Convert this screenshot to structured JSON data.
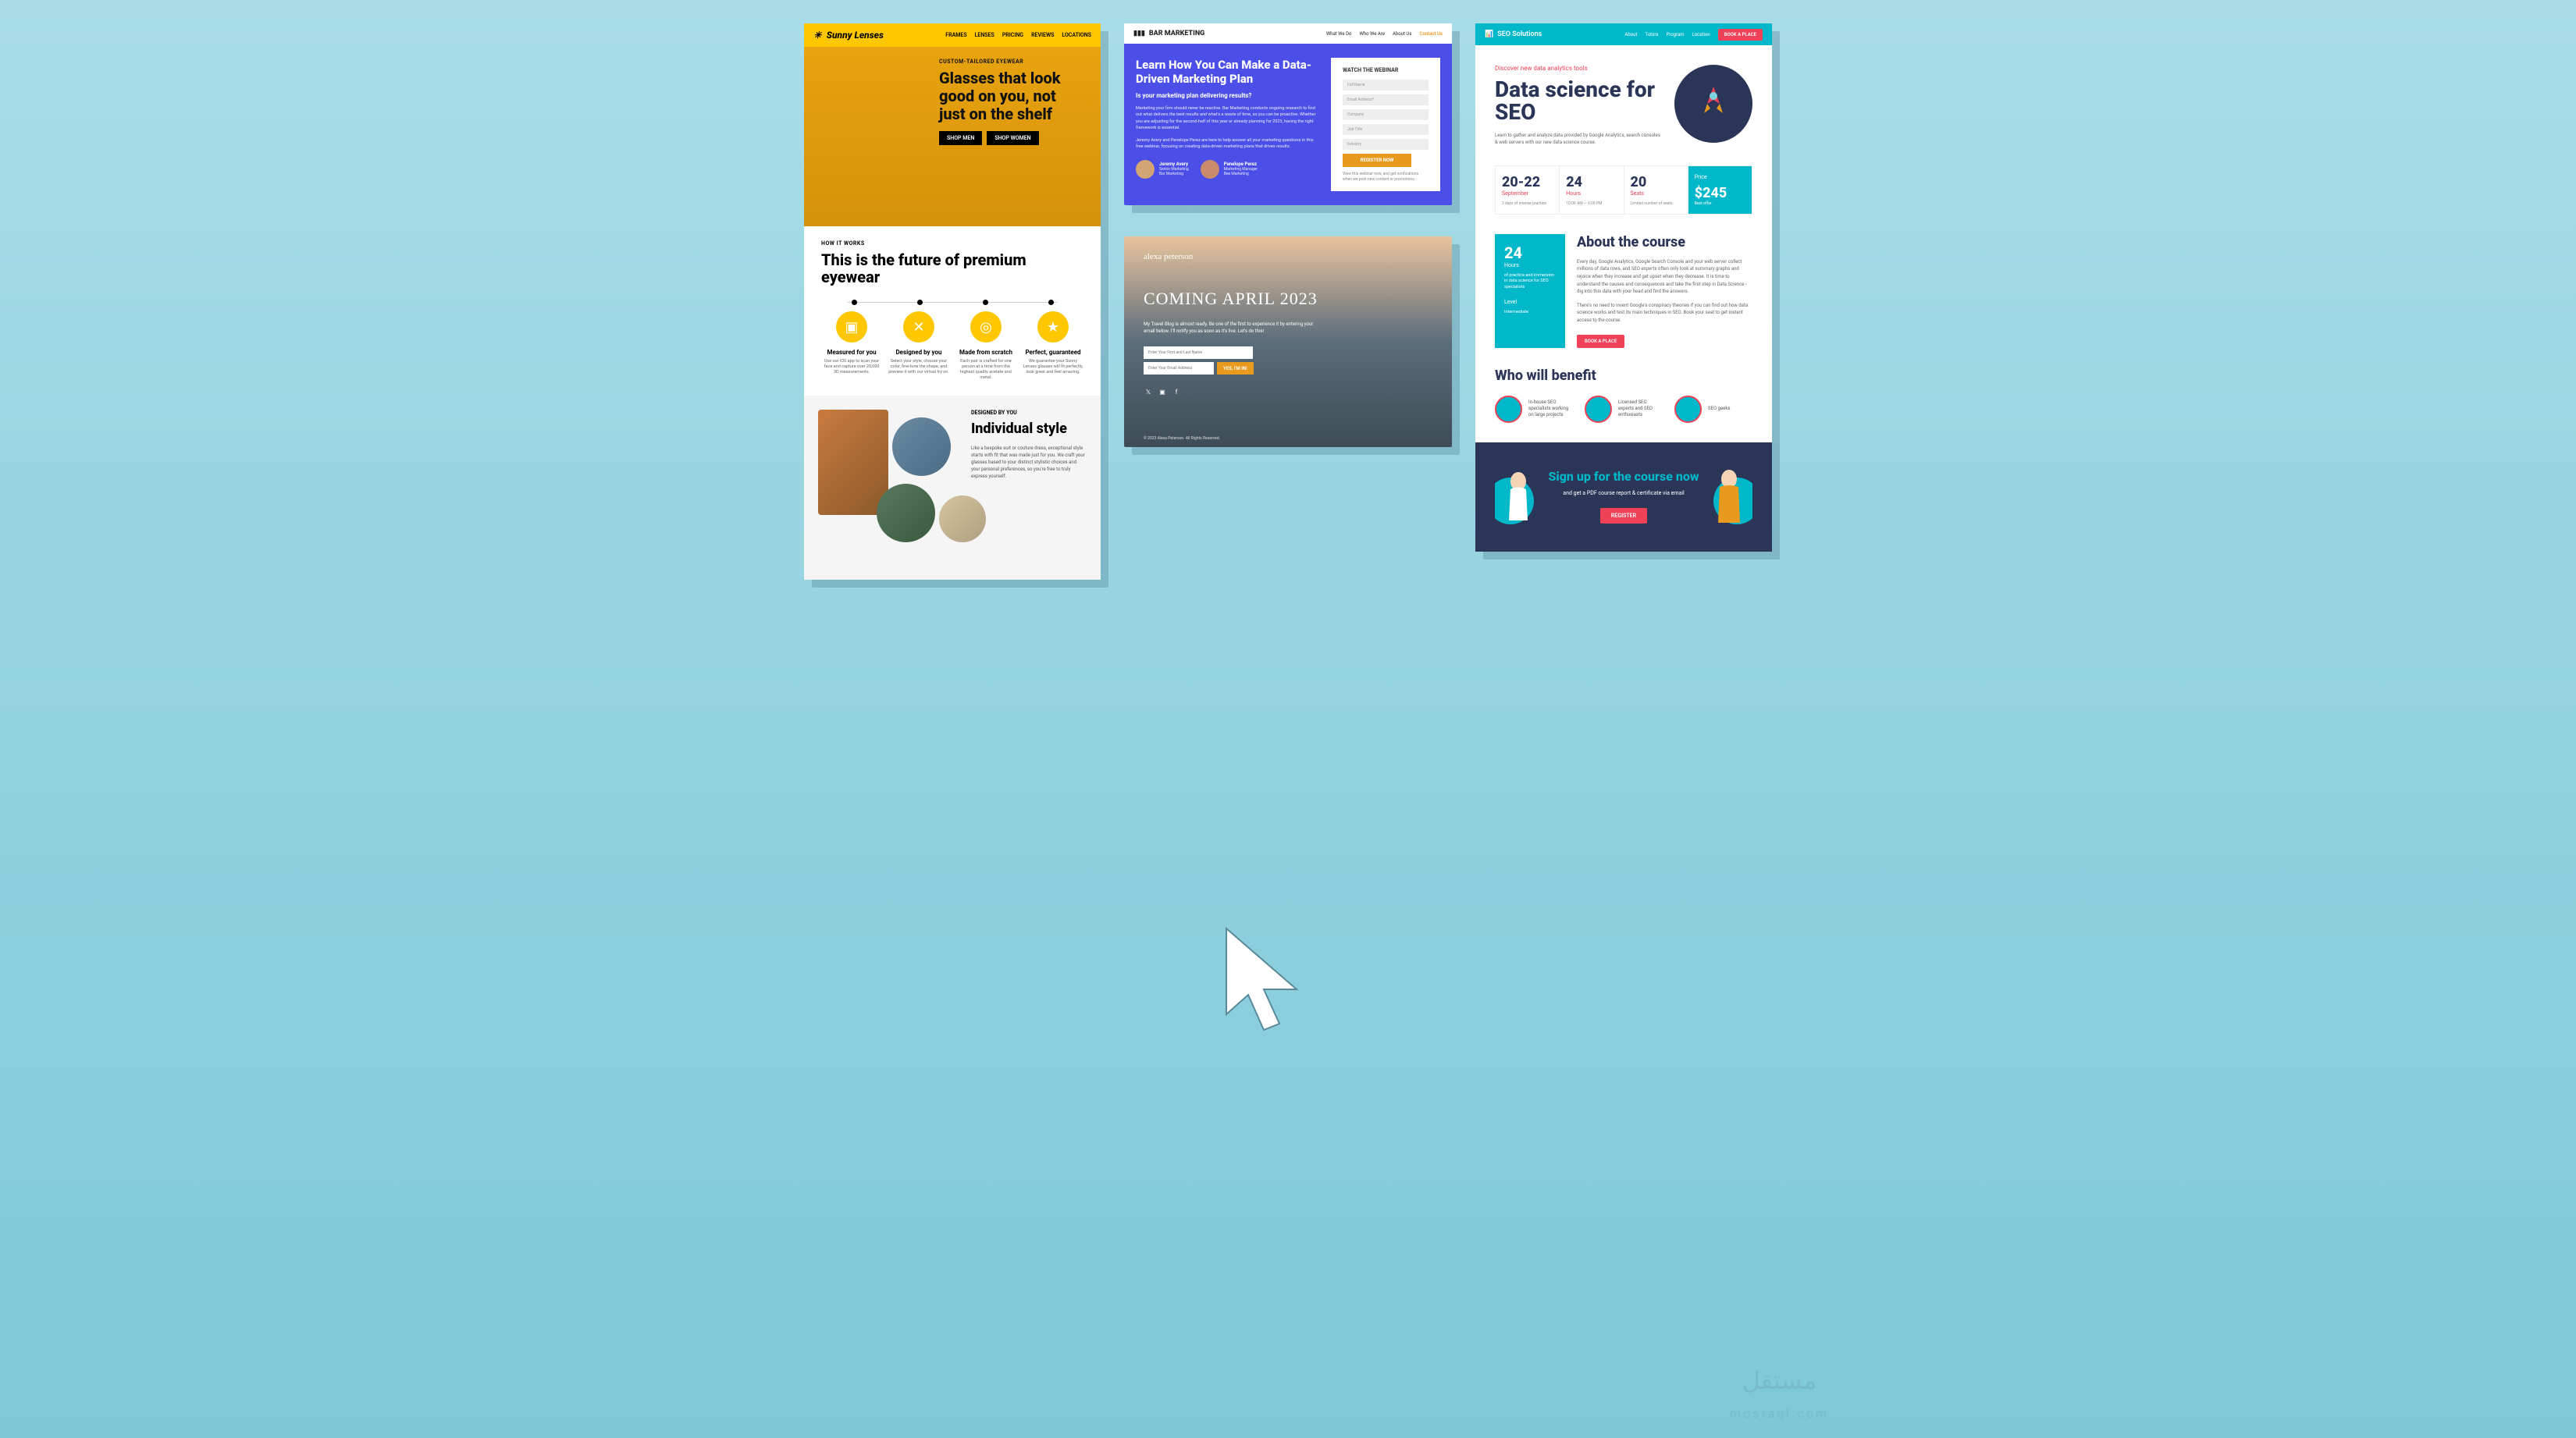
{
  "sunny": {
    "brand": "Sunny Lenses",
    "nav": [
      "FRAMES",
      "LENSES",
      "PRICING",
      "REVIEWS",
      "LOCATIONS"
    ],
    "hero": {
      "eyebrow": "CUSTOM-TAILORED EYEWEAR",
      "headline": "Glasses that look good on you, not just on the shelf",
      "shop_men": "SHOP MEN",
      "shop_women": "SHOP WOMEN"
    },
    "how": {
      "eyebrow": "HOW IT WORKS",
      "headline": "This is the future of premium eyewear",
      "features": [
        {
          "title": "Measured for you",
          "desc": "Use our iOS app to scan your face and capture over 20,000 3D measurements."
        },
        {
          "title": "Designed by you",
          "desc": "Select your style, choose your color, fine-tune the shape, and preview it with our virtual try on."
        },
        {
          "title": "Made from scratch",
          "desc": "Each pair is crafted for one person at a time from the highest quality acetate and metal."
        },
        {
          "title": "Perfect, guaranteed",
          "desc": "We guarantee your Sunny Lenses glasses will fit perfectly, look great and feel amazing."
        }
      ]
    },
    "ind": {
      "eyebrow": "DESIGNED BY YOU",
      "headline": "Individual style",
      "body": "Like a bespoke suit or couture dress, exceptional style starts with fit that was made just for you. We craft your glasses based to your distinct stylistic choices and your personal preferences, so you're free to truly express yourself."
    }
  },
  "bar": {
    "brand": "BAR MARKETING",
    "nav": [
      "What We Do",
      "Who We Are",
      "About Us",
      "Contact Us"
    ],
    "headline": "Learn How You Can Make a Data-Driven Marketing Plan",
    "sub": "Is your marketing plan delivering results?",
    "p1": "Marketing your firm should never be reactive. Bar Marketing conducts ongoing research to find out what delivers the best results and what's a waste of time, so you can be proactive. Whether you are adjusting for the second-half of this year or already planning for 2023, having the right framework is essential.",
    "p2": "Jeremy Avery and Penelope Perez are here to help answer all your marketing questions in this free webinar, focusing on creating data-driven marketing plans that drives results.",
    "people": [
      {
        "name": "Jeremy Avery",
        "title": "Senior Marketing",
        "org": "Bar Marketing"
      },
      {
        "name": "Penelope Perez",
        "title": "Marketing Manager",
        "org": "Bee Marketing"
      }
    ],
    "form": {
      "title": "WATCH THE WEBINAR",
      "fields": [
        "Full Name",
        "Email Address*",
        "Company",
        "Job Title",
        "Industry"
      ],
      "button": "REGISTER NOW",
      "note": "View this webinar now, and get notifications when we post new content or promotions."
    }
  },
  "alexa": {
    "name": "alexa peterson",
    "headline": "COMING APRIL 2023",
    "body": "My Travel Blog is almost ready. Be one of the first to experience it by entering your email below. I'll notify you as soon as it's live. Let's do this!",
    "name_ph": "Enter Your First and Last Name",
    "email_ph": "Enter Your Email Address",
    "button": "YES, I'M IN!",
    "footer": "© 2023 Alexa Peterson. All Rights Reserved."
  },
  "seo": {
    "brand": "SEO Solutions",
    "nav": [
      "About",
      "Tutors",
      "Program",
      "Location"
    ],
    "book": "BOOK A PLACE",
    "hero": {
      "eyebrow": "Discover new data analytics tools",
      "headline": "Data science for SEO",
      "body": "Learn to gather and analyze data provided by Google Analytics, search consoles & web servers with our new data science course."
    },
    "stats": [
      {
        "v": "20-22",
        "l": "September",
        "d": "3 days of intense practice"
      },
      {
        "v": "24",
        "l": "Hours",
        "d": "10:00 AM — 6:00 PM"
      },
      {
        "v": "20",
        "l": "Seats",
        "d": "Limited number of seats"
      },
      {
        "v": "$245",
        "l": "Price",
        "d": "Best offer"
      }
    ],
    "about": {
      "side_v": "24",
      "side_l": "Hours",
      "side_d": "of practice and immersion in data science for SEO specialists",
      "level_l": "Level",
      "level_v": "Intermediate",
      "headline": "About the course",
      "p1": "Every day, Google Analytics, Google Search Console and your web server collect millions of data rows, and SEO experts often only look at summary graphs and rejoice when they increase and get upset when they decrease. It is time to understand the causes and consequences and take the first step in Data Science - dig into this data with your head and find the answers.",
      "p2": "There's no need to invent Google's conspiracy theories if you can find out how data science works and test its main techniques in SEO. Book your seat to get instant access to the course.",
      "button": "BOOK A PLACE"
    },
    "benefit": {
      "headline": "Who will benefit",
      "items": [
        "In-house SEO specialists working on large projects",
        "Licensed SEO experts and SEO enthusiasts",
        "SEO geeks"
      ]
    },
    "cta": {
      "headline": "Sign up for the course now",
      "body": "and get a PDF course report & certificate via email",
      "button": "REGISTER"
    }
  },
  "watermark": "مستقل"
}
